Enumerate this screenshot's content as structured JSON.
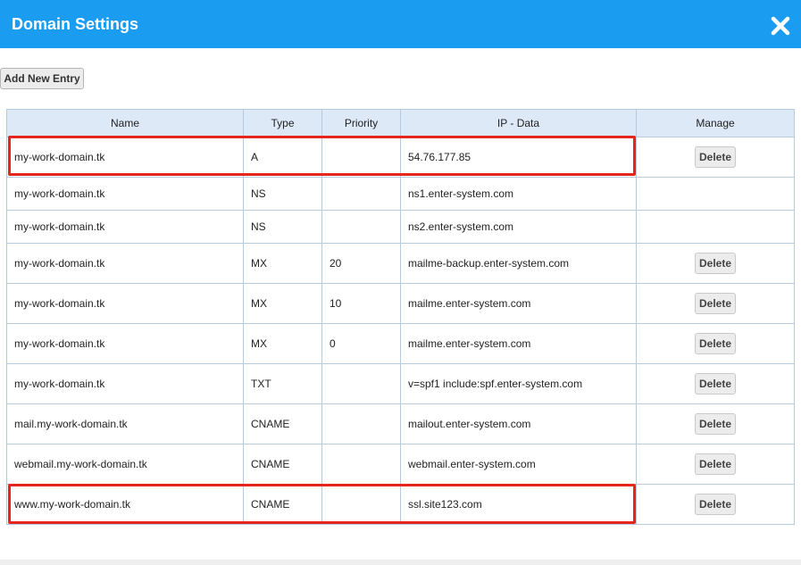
{
  "dialog": {
    "title": "Domain Settings"
  },
  "toolbar": {
    "add_label": "Add New Entry"
  },
  "table": {
    "headers": {
      "name": "Name",
      "type": "Type",
      "priority": "Priority",
      "ip_data": "IP - Data",
      "manage": "Manage"
    },
    "delete_label": "Delete",
    "rows": [
      {
        "name": "my-work-domain.tk",
        "type": "A",
        "priority": "",
        "data": "54.76.177.85",
        "deletable": true,
        "highlighted": true
      },
      {
        "name": "my-work-domain.tk",
        "type": "NS",
        "priority": "",
        "data": "ns1.enter-system.com",
        "deletable": false,
        "highlighted": false
      },
      {
        "name": "my-work-domain.tk",
        "type": "NS",
        "priority": "",
        "data": "ns2.enter-system.com",
        "deletable": false,
        "highlighted": false
      },
      {
        "name": "my-work-domain.tk",
        "type": "MX",
        "priority": "20",
        "data": "mailme-backup.enter-system.com",
        "deletable": true,
        "highlighted": false
      },
      {
        "name": "my-work-domain.tk",
        "type": "MX",
        "priority": "10",
        "data": "mailme.enter-system.com",
        "deletable": true,
        "highlighted": false
      },
      {
        "name": "my-work-domain.tk",
        "type": "MX",
        "priority": "0",
        "data": "mailme.enter-system.com",
        "deletable": true,
        "highlighted": false
      },
      {
        "name": "my-work-domain.tk",
        "type": "TXT",
        "priority": "",
        "data": "v=spf1 include:spf.enter-system.com",
        "deletable": true,
        "highlighted": false
      },
      {
        "name": "mail.my-work-domain.tk",
        "type": "CNAME",
        "priority": "",
        "data": "mailout.enter-system.com",
        "deletable": true,
        "highlighted": false
      },
      {
        "name": "webmail.my-work-domain.tk",
        "type": "CNAME",
        "priority": "",
        "data": "webmail.enter-system.com",
        "deletable": true,
        "highlighted": false
      },
      {
        "name": "www.my-work-domain.tk",
        "type": "CNAME",
        "priority": "",
        "data": "ssl.site123.com",
        "deletable": true,
        "highlighted": true
      }
    ]
  },
  "colors": {
    "titlebar": "#1a9cf0",
    "header_bg": "#dde9f6",
    "border": "#b7c9dc",
    "highlight": "#e8251c"
  },
  "icons": {
    "close": "close-icon"
  }
}
